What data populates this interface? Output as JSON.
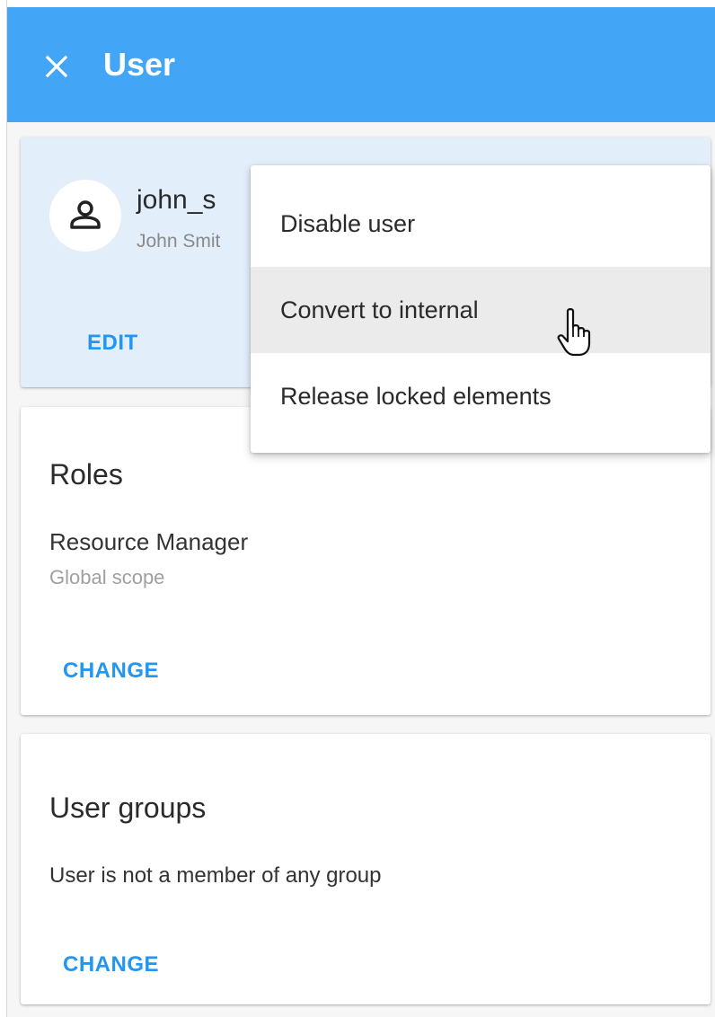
{
  "header": {
    "title": "User",
    "close_icon": "close-icon",
    "background_color": "#42a5f5"
  },
  "user_card": {
    "avatar_icon": "person-icon",
    "username": "john_s",
    "full_name": "John Smit",
    "edit_label": "EDIT"
  },
  "menu": {
    "items": [
      {
        "label": "Disable user"
      },
      {
        "label": "Convert to internal",
        "hovered": true
      },
      {
        "label": "Release locked elements"
      }
    ]
  },
  "roles": {
    "title": "Roles",
    "role_name": "Resource Manager",
    "scope": "Global scope",
    "change_label": "CHANGE"
  },
  "user_groups": {
    "title": "User groups",
    "empty_text": "User is not a member of any group",
    "change_label": "CHANGE"
  },
  "colors": {
    "accent": "#2196f3",
    "user_card_background": "#e3eefb",
    "menu_hover": "#ebebeb"
  },
  "cursor_icon": "hand-pointer-icon"
}
